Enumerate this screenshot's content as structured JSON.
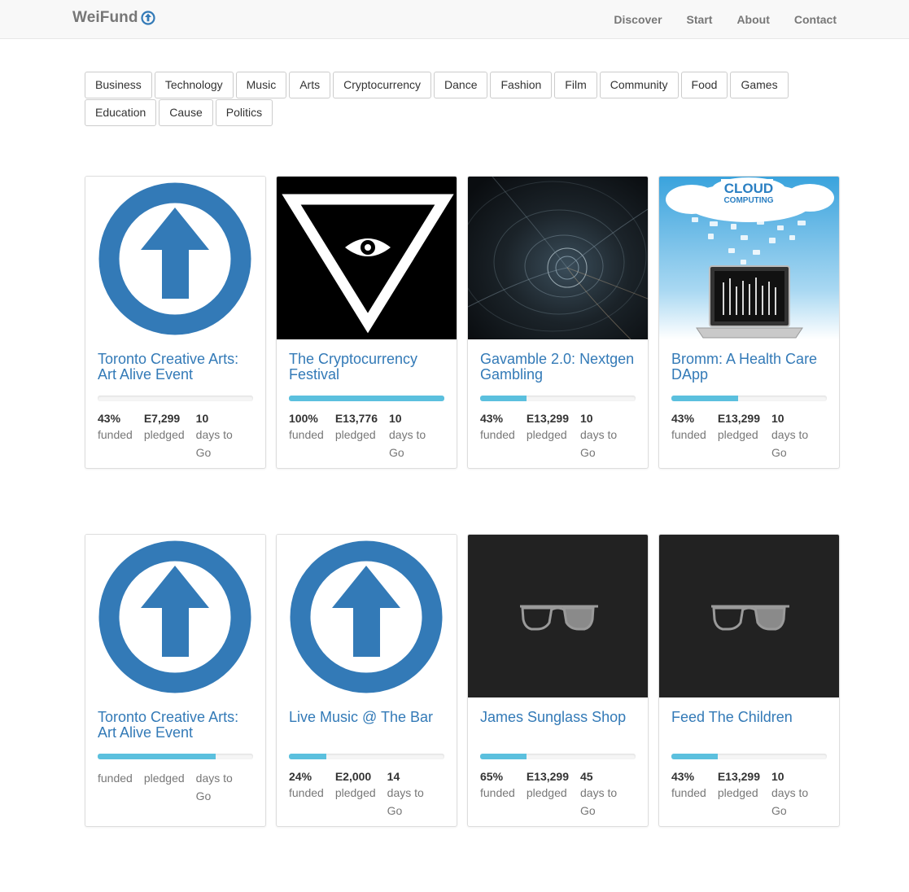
{
  "navbar": {
    "brand": "WeiFund",
    "brand_icon": "arrow-up-circle-icon",
    "links": [
      "Discover",
      "Start",
      "About",
      "Contact"
    ]
  },
  "categories": [
    "Business",
    "Technology",
    "Music",
    "Arts",
    "Cryptocurrency",
    "Dance",
    "Fashion",
    "Film",
    "Community",
    "Food",
    "Games",
    "Education",
    "Cause",
    "Politics"
  ],
  "labels": {
    "funded": "funded",
    "pledged": "pledged",
    "days": "days to Go"
  },
  "colors": {
    "brand_blue": "#337ab7",
    "progress": "#5bc0de"
  },
  "campaigns_row1": [
    {
      "title": "Toronto Creative Arts: Art Alive Event",
      "image": "weifund-logo",
      "progress": 0.0,
      "funded": "43%",
      "pledged": "E7,299",
      "days": "10"
    },
    {
      "title": "The Cryptocurrency Festival",
      "image": "triangle-eye",
      "progress": 1.0,
      "funded": "100%",
      "pledged": "E13,776",
      "days": "10"
    },
    {
      "title": "Gavamble 2.0: Nextgen Gambling",
      "image": "fractal-vortex",
      "progress": 0.3,
      "funded": "43%",
      "pledged": "E13,299",
      "days": "10"
    },
    {
      "title": "Bromm: A Health Care DApp",
      "image": "cloud-computing",
      "progress": 0.43,
      "funded": "43%",
      "pledged": "E13,299",
      "days": "10"
    }
  ],
  "campaigns_row2": [
    {
      "title": "Toronto Creative Arts: Art Alive Event",
      "image": "weifund-logo",
      "progress": 0.76,
      "funded": "",
      "pledged": "",
      "days": ""
    },
    {
      "title": "Live Music @ The Bar",
      "image": "weifund-logo",
      "progress": 0.24,
      "funded": "24%",
      "pledged": "E2,000",
      "days": "14"
    },
    {
      "title": "James Sunglass Shop",
      "image": "sunglasses",
      "progress": 0.3,
      "funded": "65%",
      "pledged": "E13,299",
      "days": "45"
    },
    {
      "title": "Feed The Children",
      "image": "sunglasses",
      "progress": 0.3,
      "funded": "43%",
      "pledged": "E13,299",
      "days": "10"
    }
  ]
}
